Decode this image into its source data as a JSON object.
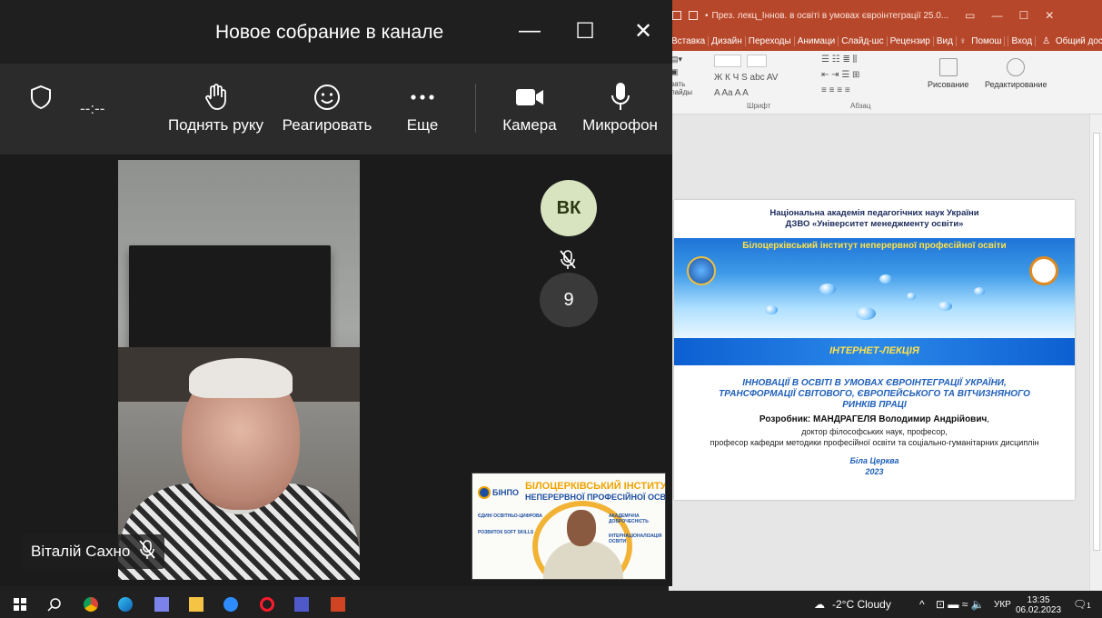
{
  "teams": {
    "title": "Новое собрание в канале",
    "timer": "--:--",
    "toolbar": {
      "raise_hand": "Поднять руку",
      "react": "Реагировать",
      "more": "Еще",
      "camera": "Камера",
      "microphone": "Микрофон"
    },
    "participant_name": "Віталій Сахно",
    "avatar_initials": "ВК",
    "others_count": "9"
  },
  "powerpoint": {
    "title": "През. лекц_Іннов. в освіті в умовах євроінтеграції  25.0...",
    "menu": [
      "Вставка",
      "Дизайн",
      "Переходы",
      "Анимаци",
      "Слайд-шс",
      "Рецензир",
      "Вид"
    ],
    "help": "Помош",
    "login": "Вход",
    "share": "Общий доступ",
    "ribbon": {
      "left_partial_1": "вать",
      "left_partial_2": "лайды",
      "font_label": "Шрифт",
      "paragraph_label": "Абзац",
      "draw": "Рисование",
      "edit": "Редактирование",
      "font_tools": "Ж  К  Ч  S  abc  AV",
      "font_tools2": "A  Aa  A  A"
    },
    "slide": {
      "header_line1": "Національна академія педагогічних наук України",
      "header_line2": "ДЗВО «Університет менеджменту освіти»",
      "institute": "Білоцерківський інститут неперервної професійної освіти",
      "lecture_type": "ІНТЕРНЕТ-ЛЕКЦІЯ",
      "topic_line1": "ІННОВАЦІЇ  В ОСВІТІ В УМОВАХ ЄВРОІНТЕГРАЦІЇ УКРАЇНИ,",
      "topic_line2": "ТРАНСФОРМАЦІЇ СВІТОВОГО, ЄВРОПЕЙСЬКОГО ТА ВІТЧИЗНЯНОГО",
      "topic_line3": "РИНКІВ ПРАЦІ",
      "author_label": "Розробник: МАНДРАГЕЛЯ Володимир Андрійович",
      "author_title1": "доктор філософських наук, професор,",
      "author_title2": "професор кафедри методики професійної освіти та соціально-гуманітарних дисциплін",
      "city": "Біла Церква",
      "year": "2023"
    }
  },
  "pip": {
    "logo": "БІНПО",
    "title1": "БІЛОЦЕРКІВСЬКИЙ ІНСТИТУТ",
    "title2": "НЕПЕРЕРВНОЇ ПРОФЕСІЙНОЇ ОСВІТИ",
    "line_a": "ЄДИНІ ОСВІТНЬО-ЦИФРОВА",
    "line_b": "РОЗВИТОК SOFT SKILLS",
    "line_c": "АКАДЕМІЧНА ДОБРОЧЕСНІСТЬ",
    "line_d": "ІНТЕРНАЦІОНАЛІЗАЦІЯ ОСВІТИ"
  },
  "taskbar": {
    "weather": "-2°C  Cloudy",
    "language": "УКР",
    "time": "13:35",
    "date": "06.02.2023",
    "notifications": "1"
  }
}
